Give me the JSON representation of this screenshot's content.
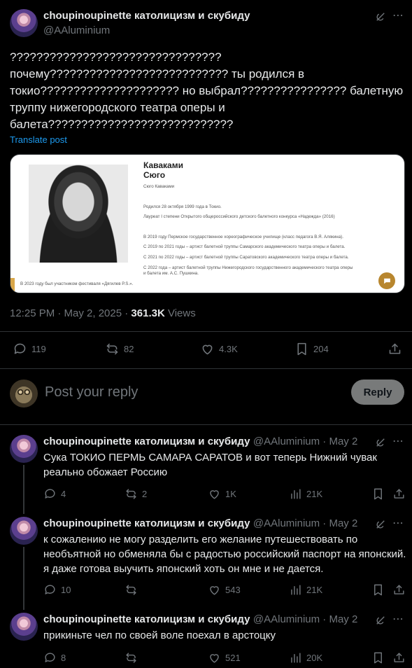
{
  "main_tweet": {
    "display_name": "choupinoupinette католицизм и скубиду",
    "handle": "@AAluminium",
    "text_lines": [
      "????????????????????????????????",
      "почему??????????????????????????? ты родился в",
      "токио????????????????????? но выбрал???????????????? балетную",
      "труппу нижегородского театра оперы и",
      "балета????????????????????????????"
    ],
    "translate_label": "Translate post",
    "timestamp": "12:25 PM · May 2, 2025 · ",
    "views_count": "361.3K",
    "views_label": " Views",
    "stats": {
      "replies": "119",
      "reposts": "82",
      "likes": "4.3K",
      "bookmarks": "204"
    }
  },
  "image_card": {
    "title_line1": "Каваками",
    "title_line2": "Сюго",
    "subtitle": "Сюго Каваками",
    "lines": [
      "Родился 28 октября 1999 года в Токио.",
      "Лауреат I степени Открытого общероссийского детского балетного конкурса «Надежда» (2016)",
      "В 2019 году Пермское государственное хореографическое училище (класс педагога В.Я. Алякина).",
      "С 2019 по 2021 годы – артист балетной труппы Самарского академического театра оперы и балета.",
      "С 2021 по 2022 годы – артист балетной труппы Саратовского академического театра оперы и балета.",
      "С 2022 года – артист балетной труппы Нижегородского государственного академического театра оперы",
      "и балета им. А.С. Пушкина."
    ],
    "footer": "В 2023 году был участником фестиваля «Дягилев P.S.»."
  },
  "compose": {
    "placeholder": "Post your reply",
    "reply_button": "Reply"
  },
  "replies": [
    {
      "display_name": "choupinoupinette католицизм и скубиду",
      "handle": "@AAluminium · May 2",
      "text_lines": [
        "Сука ТОКИО ПЕРМЬ САМАРА САРАТОВ и вот теперь Нижний чувак",
        "реально обожает Россию"
      ],
      "stats": {
        "replies": "4",
        "reposts": "2",
        "likes": "1K",
        "views": "21K"
      }
    },
    {
      "display_name": "choupinoupinette католицизм и скубиду",
      "handle": "@AAluminium · May 2",
      "text_lines": [
        "к сожалению не могу разделить его желание путешествовать по",
        "необъятной но обменяла бы с радостью российский паспорт на японский.",
        "я даже готова выучить японский хоть он мне и не дается."
      ],
      "stats": {
        "replies": "10",
        "reposts": "",
        "likes": "543",
        "views": "21K"
      }
    },
    {
      "display_name": "choupinoupinette католицизм и скубиду",
      "handle": "@AAluminium · May 2",
      "text_lines": [
        "прикиньте чел по своей воле поехал в арстоцку"
      ],
      "stats": {
        "replies": "8",
        "reposts": "",
        "likes": "521",
        "views": "20K"
      }
    }
  ],
  "colors": {
    "background": "#000000",
    "text": "#e7e9ea",
    "muted": "#71767b",
    "link": "#1d9bf0",
    "divider": "#2f3336"
  }
}
